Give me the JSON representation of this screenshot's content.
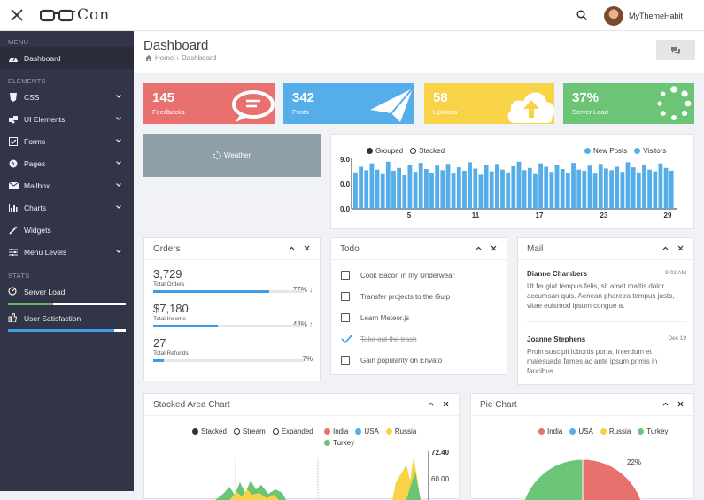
{
  "brand": {
    "name": "Con"
  },
  "user": {
    "name": "MyThemeHabit"
  },
  "sidebar": {
    "menu_heading": "MENU",
    "elements_heading": "ELEMENTS",
    "stats_heading": "STATS",
    "items": [
      {
        "label": "Dashboard",
        "icon": "dashboard-icon",
        "active": true
      },
      {
        "label": "CSS",
        "icon": "css3-icon"
      },
      {
        "label": "UI Elements",
        "icon": "puzzle-icon"
      },
      {
        "label": "Forms",
        "icon": "check-square-icon"
      },
      {
        "label": "Pages",
        "icon": "globe-icon"
      },
      {
        "label": "Mailbox",
        "icon": "envelope-icon"
      },
      {
        "label": "Charts",
        "icon": "bar-chart-icon"
      },
      {
        "label": "Widgets",
        "icon": "magic-icon"
      },
      {
        "label": "Menu Levels",
        "icon": "sliders-icon"
      }
    ],
    "stats": [
      {
        "label": "Server Load",
        "icon": "server-load-icon",
        "fill": 0.38,
        "color": "#5cb85c"
      },
      {
        "label": "User Satisfaction",
        "icon": "thumbs-up-icon",
        "fill": 0.9,
        "color": "#3f9be3"
      }
    ]
  },
  "header": {
    "title": "Dashboard",
    "breadcrumb": [
      "Home",
      "Dashboard"
    ]
  },
  "tiles": [
    {
      "value": "145",
      "label": "Feedbacks",
      "color": "#e8706f",
      "icon": "comments-icon"
    },
    {
      "value": "342",
      "label": "Posts",
      "color": "#55aee9",
      "icon": "paper-plane-icon"
    },
    {
      "value": "58",
      "label": "Uploads",
      "color": "#f8d347",
      "icon": "cloud-upload-icon"
    },
    {
      "value": "37%",
      "label": "Server Load",
      "color": "#6cc576",
      "icon": "spinner-icon"
    }
  ],
  "weather": {
    "label": "Weather"
  },
  "chart_data": [
    {
      "type": "bar",
      "legend_controls": [
        "Grouped",
        "Stacked"
      ],
      "series": [
        {
          "name": "New Posts",
          "color": "#55aee9"
        },
        {
          "name": "Visitors",
          "color": "#55aee9"
        }
      ],
      "y_ticks": [
        "9.0",
        "0.0",
        "0.0"
      ],
      "x_ticks": [
        "5",
        "11",
        "17",
        "23",
        "29"
      ],
      "values": [
        6.5,
        7.5,
        6.9,
        8.1,
        7.0,
        6.2,
        8.4,
        6.8,
        7.3,
        6.0,
        7.9,
        6.6,
        8.2,
        7.1,
        6.4,
        7.7,
        6.9,
        8.0,
        6.3,
        7.4,
        6.8,
        8.3,
        7.2,
        6.1,
        7.8,
        6.7,
        8.0,
        7.0,
        6.5,
        7.6,
        8.4,
        6.9,
        7.3,
        6.2,
        8.1,
        7.5,
        6.6,
        7.9,
        7.1,
        6.4,
        8.2,
        7.0,
        6.8,
        7.7,
        6.3,
        8.0,
        7.2,
        6.9,
        7.5,
        6.6,
        8.3,
        7.4,
        6.5,
        7.8,
        7.0,
        6.7,
        8.1,
        7.3,
        6.8
      ]
    },
    {
      "type": "area",
      "title": "Stacked Area Chart",
      "legend_controls": [
        "Stacked",
        "Stream",
        "Expanded"
      ],
      "series": [
        {
          "name": "India",
          "color": "#e8706f"
        },
        {
          "name": "USA",
          "color": "#55aee9"
        },
        {
          "name": "Russia",
          "color": "#f8d347"
        },
        {
          "name": "Turkey",
          "color": "#6cc576"
        }
      ],
      "y_ticks": [
        "72.40",
        "60.00"
      ]
    },
    {
      "type": "pie",
      "title": "Pie Chart",
      "series": [
        {
          "name": "India",
          "color": "#e8706f"
        },
        {
          "name": "USA",
          "color": "#55aee9"
        },
        {
          "name": "Russia",
          "color": "#f8d347"
        },
        {
          "name": "Turkey",
          "color": "#6cc576"
        }
      ],
      "labels": [
        "22%"
      ]
    }
  ],
  "orders": {
    "title": "Orders",
    "rows": [
      {
        "value": "3,729",
        "label": "Total Orders",
        "pct": "77%",
        "fill": 0.77,
        "trend": "down"
      },
      {
        "value": "$7,180",
        "label": "Total Income",
        "pct": "43%",
        "fill": 0.43,
        "trend": "up"
      },
      {
        "value": "27",
        "label": "Total Refunds",
        "pct": "7%",
        "fill": 0.07,
        "trend": "none"
      }
    ]
  },
  "todo": {
    "title": "Todo",
    "items": [
      {
        "label": "Cook Bacon in my Underwear",
        "done": false
      },
      {
        "label": "Transfer projects to the Gulp",
        "done": false
      },
      {
        "label": "Learn Meteor.js",
        "done": false
      },
      {
        "label": "Take out the trash",
        "done": true
      },
      {
        "label": "Gain popularity on Envato",
        "done": false
      }
    ]
  },
  "mail": {
    "title": "Mail",
    "items": [
      {
        "from": "Dianne Chambers",
        "date": "9:02 AM",
        "body": "Ut feugiat tempus felis, sit amet mattis dolor accumsan quis. Aenean pharetra tempus justo, vitae euismod ipsum congue a."
      },
      {
        "from": "Joanne Stephens",
        "date": "Dec 19",
        "body": "Proin suscipit lobortis porta. Interdum et malesuada fames ac ante ipsum primis in faucibus."
      }
    ]
  }
}
